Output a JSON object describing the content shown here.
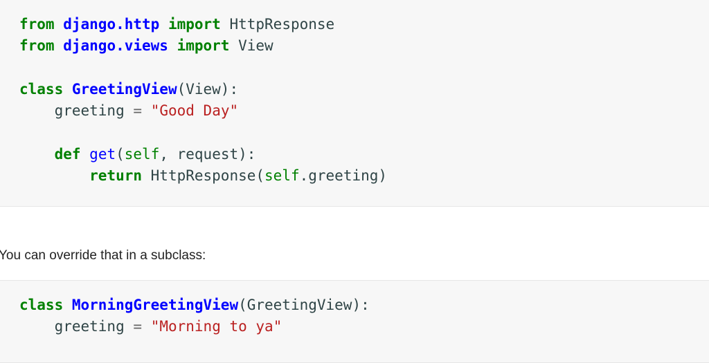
{
  "code_blocks": [
    {
      "lines": [
        [
          [
            "kw",
            "from"
          ],
          [
            "",
            "  "
          ],
          [
            "nm",
            "django.http"
          ],
          [
            "",
            ""
          ],
          [
            "kw",
            " import"
          ],
          [
            "",
            " HttpResponse"
          ]
        ],
        [
          [
            "kw",
            "from"
          ],
          [
            "",
            " "
          ],
          [
            "nm",
            "django.views"
          ],
          [
            "kw",
            " import"
          ],
          [
            "",
            " View"
          ]
        ],
        [],
        [
          [
            "kw",
            "class"
          ],
          [
            "",
            " "
          ],
          [
            "nm",
            "GreetingView"
          ],
          [
            "",
            "(View):"
          ]
        ],
        [
          [
            "",
            "    greeting "
          ],
          [
            "op",
            "="
          ],
          [
            "",
            " "
          ],
          [
            "st",
            "\"Good Day\""
          ]
        ],
        [],
        [
          [
            "kw",
            "    def"
          ],
          [
            "",
            " "
          ],
          [
            "fn",
            "get"
          ],
          [
            "",
            "("
          ],
          [
            "bi",
            "self"
          ],
          [
            "",
            ", request):"
          ]
        ],
        [
          [
            "kw",
            "        return"
          ],
          [
            "",
            " HttpResponse("
          ],
          [
            "bi",
            "self"
          ],
          [
            "",
            ".greeting)"
          ]
        ]
      ]
    },
    {
      "lines": [
        [
          [
            "kw",
            "class"
          ],
          [
            "",
            " "
          ],
          [
            "nm",
            "MorningGreetingView"
          ],
          [
            "",
            "(GreetingView):"
          ]
        ],
        [
          [
            "",
            "    greeting "
          ],
          [
            "op",
            "="
          ],
          [
            "",
            " "
          ],
          [
            "st",
            "\"Morning to ya\""
          ]
        ]
      ]
    }
  ],
  "prose": "You can override that in a subclass:"
}
